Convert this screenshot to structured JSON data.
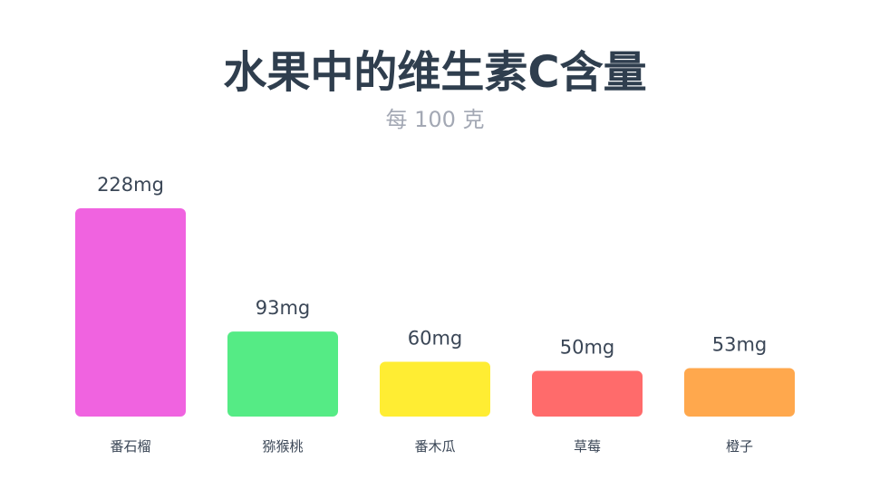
{
  "chart_data": {
    "type": "bar",
    "title": "水果中的维生素C含量",
    "subtitle": "每 100 克",
    "unit": "mg",
    "categories": [
      "番石榴",
      "猕猴桃",
      "番木瓜",
      "草莓",
      "橙子"
    ],
    "values": [
      228,
      93,
      60,
      50,
      53
    ],
    "value_labels": [
      "228mg",
      "93mg",
      "60mg",
      "50mg",
      "53mg"
    ],
    "colors": [
      "#f063e0",
      "#55eb85",
      "#ffed33",
      "#ff6b6b",
      "#ffa84d"
    ],
    "ylim": [
      0,
      228
    ],
    "grid": false,
    "legend": "none"
  }
}
